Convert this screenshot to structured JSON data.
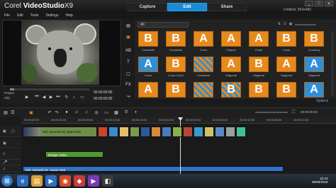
{
  "app": {
    "brand_prefix": "Corel",
    "brand_name": "VideoStudio",
    "brand_version": "X9",
    "project_name": "Untitled, 854x480"
  },
  "tabs": [
    {
      "label": "Capture"
    },
    {
      "label": "Edit"
    },
    {
      "label": "Share"
    }
  ],
  "window_buttons": [
    "_",
    "□",
    "✕"
  ],
  "menu": [
    "File",
    "Edit",
    "Tools",
    "Settings",
    "Help"
  ],
  "preview": {
    "mode_project": "Project",
    "mode_clip": "Clip",
    "timecode_current": "00:00:00:00",
    "timecode_total": "00:00:00:00"
  },
  "library": {
    "folder": "All",
    "options_label": "Options",
    "row1": [
      {
        "label": "Crossfade",
        "glyph": "B",
        "style": "orange"
      },
      {
        "label": "Crossfade",
        "glyph": "B",
        "style": "orange"
      },
      {
        "label": "Cross",
        "glyph": "A",
        "style": "orange"
      },
      {
        "label": "Clapper",
        "glyph": "A",
        "style": "orange"
      },
      {
        "label": "Cross",
        "glyph": "A",
        "style": "orange"
      },
      {
        "label": "Cross",
        "glyph": "B",
        "style": "orange"
      },
      {
        "label": "Crossing",
        "glyph": "B",
        "style": "orange"
      }
    ],
    "row2": [
      {
        "label": "Cross",
        "glyph": "A",
        "style": "blue"
      },
      {
        "label": "Cross Zoom",
        "glyph": "B",
        "style": "orange"
      },
      {
        "label": "Crossfade",
        "glyph": "",
        "style": "check"
      },
      {
        "label": "Diagonal",
        "glyph": "A",
        "style": "orange"
      },
      {
        "label": "Diagonal",
        "glyph": "B",
        "style": "orange"
      },
      {
        "label": "Diagonal",
        "glyph": "A",
        "style": "orange"
      },
      {
        "label": "Diagonal",
        "glyph": "A",
        "style": "blue"
      }
    ],
    "row3": [
      {
        "label": "",
        "glyph": "A",
        "style": "orange"
      },
      {
        "label": "",
        "glyph": "B",
        "style": "orange"
      },
      {
        "label": "",
        "glyph": "",
        "style": "check"
      },
      {
        "label": "",
        "glyph": "B",
        "style": "check"
      },
      {
        "label": "",
        "glyph": "B",
        "style": "orange"
      },
      {
        "label": "",
        "glyph": "B",
        "style": "orange"
      },
      {
        "label": "",
        "glyph": "A",
        "style": "blue"
      }
    ]
  },
  "timeline": {
    "ruler": [
      "00:00:00:00",
      "00:00:04:00",
      "00:00:08:00",
      "00:00:12:00",
      "00:00:16:00",
      "00:00:20:00",
      "00:00:24:00",
      "00:00:28:00",
      "00:00:32:00",
      "00:00:36:00",
      "00:00:40:00"
    ],
    "video_clip_label": "HM_General 16_Start.wmv",
    "title_clip_label": "Belajar Video",
    "music_clip_label": "HM_General 16_music.mpa"
  },
  "taskbar": {
    "time": "22:42",
    "date": "08/06/2016"
  },
  "colors": {
    "accent": "#1a8ad4",
    "transition_orange": "#e68a1e",
    "transition_blue": "#2f8fd6"
  }
}
